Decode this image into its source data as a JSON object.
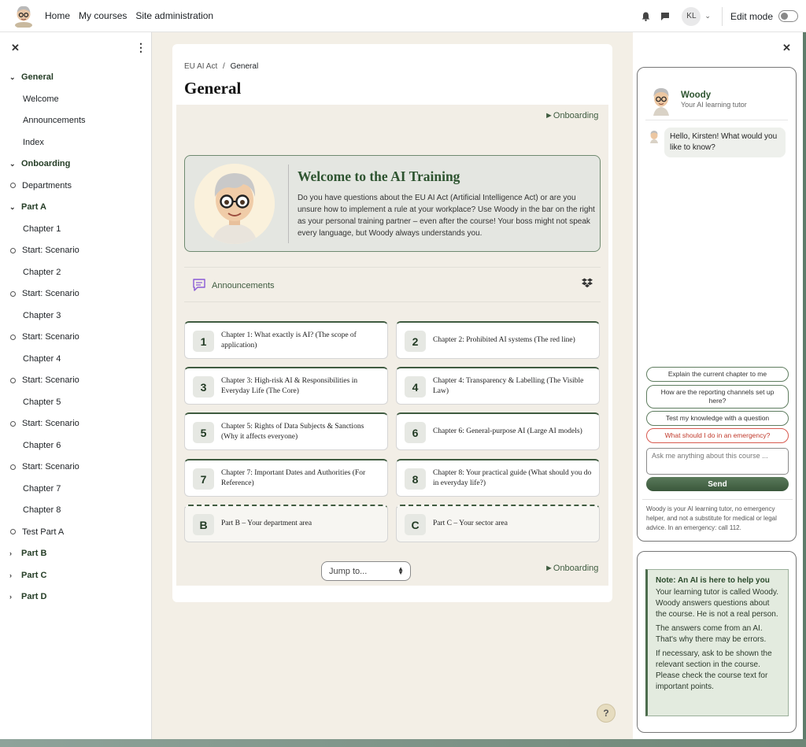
{
  "navbar": {
    "links": [
      "Home",
      "My courses",
      "Site administration"
    ],
    "avatar_initials": "KL",
    "edit_mode_label": "Edit mode"
  },
  "course_index": {
    "items": [
      {
        "label": "General",
        "kind": "section"
      },
      {
        "label": "Welcome",
        "kind": "page"
      },
      {
        "label": "Announcements",
        "kind": "page"
      },
      {
        "label": "Index",
        "kind": "page"
      },
      {
        "label": "Onboarding",
        "kind": "section"
      },
      {
        "label": "Departments",
        "kind": "activity"
      },
      {
        "label": "Part A",
        "kind": "section"
      },
      {
        "label": "Chapter 1",
        "kind": "page"
      },
      {
        "label": "Start: Scenario",
        "kind": "activity"
      },
      {
        "label": "Chapter 2",
        "kind": "page"
      },
      {
        "label": "Start: Scenario",
        "kind": "activity"
      },
      {
        "label": "Chapter 3",
        "kind": "page"
      },
      {
        "label": "Start: Scenario",
        "kind": "activity"
      },
      {
        "label": "Chapter 4",
        "kind": "page"
      },
      {
        "label": "Start: Scenario",
        "kind": "activity"
      },
      {
        "label": "Chapter 5",
        "kind": "page"
      },
      {
        "label": "Start: Scenario",
        "kind": "activity"
      },
      {
        "label": "Chapter 6",
        "kind": "page"
      },
      {
        "label": "Start: Scenario",
        "kind": "activity"
      },
      {
        "label": "Chapter 7",
        "kind": "page"
      },
      {
        "label": "Chapter 8",
        "kind": "page"
      },
      {
        "label": "Test Part A",
        "kind": "activity"
      },
      {
        "label": "Part B",
        "kind": "collapsed"
      },
      {
        "label": "Part C",
        "kind": "collapsed"
      },
      {
        "label": "Part D",
        "kind": "collapsed"
      }
    ]
  },
  "main": {
    "breadcrumb": {
      "course": "EU AI Act",
      "separator": "/",
      "current": "General"
    },
    "title": "General",
    "onboarding_link": "►Onboarding",
    "welcome": {
      "title": "Welcome to the AI Training",
      "text": "Do you have questions about the EU AI Act (Artificial Intelligence Act) or are you unsure how to implement a rule at your workplace? Use Woody in the bar on the right as your personal training partner – even after the course! Your boss might not speak every language, but Woody always understands you."
    },
    "announcements_label": "Announcements",
    "tiles": [
      {
        "num": "1",
        "text": "Chapter 1: What exactly is AI? (The scope of application)"
      },
      {
        "num": "2",
        "text": "Chapter 2: Prohibited AI systems (The red line)"
      },
      {
        "num": "3",
        "text": "Chapter 3: High-risk AI & Responsibilities in Everyday Life (The Core)"
      },
      {
        "num": "4",
        "text": "Chapter 4: Transparency & Labelling (The Visible Law)"
      },
      {
        "num": "5",
        "text": "Chapter 5: Rights of Data Subjects & Sanctions (Why it affects everyone)"
      },
      {
        "num": "6",
        "text": "Chapter 6: General-purpose AI (Large AI models)"
      },
      {
        "num": "7",
        "text": "Chapter 7: Important Dates and Authorities (For Reference)"
      },
      {
        "num": "8",
        "text": "Chapter 8: Your practical guide (What should you do in everyday life?)"
      },
      {
        "num": "B",
        "text": "Part B – Your department area"
      },
      {
        "num": "C",
        "text": "Part C – Your sector area"
      }
    ],
    "jump_to": "Jump to..."
  },
  "help_button": "?",
  "chat": {
    "name": "Woody",
    "subtitle": "Your AI learning tutor",
    "greeting": "Hello, Kirsten! What would you like to know?",
    "suggestions": [
      "Explain the current chapter to me",
      "How are the reporting channels set up here?",
      "Test my knowledge with a question",
      "What should I do in an emergency?"
    ],
    "input_placeholder": "Ask me anything about this course ...",
    "send_label": "Send",
    "disclaimer": "Woody is your AI learning tutor, no emergency helper, and not a substitute for medical or legal advice. In an emergency: call 112."
  },
  "note": {
    "title": "Note: An AI is here to help you",
    "paragraphs": [
      "Your learning tutor is called Woody. Woody answers questions about the course. He is not a real person.",
      "The answers come from an AI. That's why there may be errors.",
      "If necessary, ask to be shown the relevant section in the course. Please check the course text for important points."
    ]
  },
  "colors": {
    "accent": "#3f5b40",
    "page_bg": "#f3efe6",
    "emergency": "#d85a50"
  },
  "icons": [
    "logo-avatar",
    "bell-icon",
    "chat-icon",
    "close-icon",
    "kebab-icon",
    "announcement-icon",
    "dropbox-icon"
  ]
}
